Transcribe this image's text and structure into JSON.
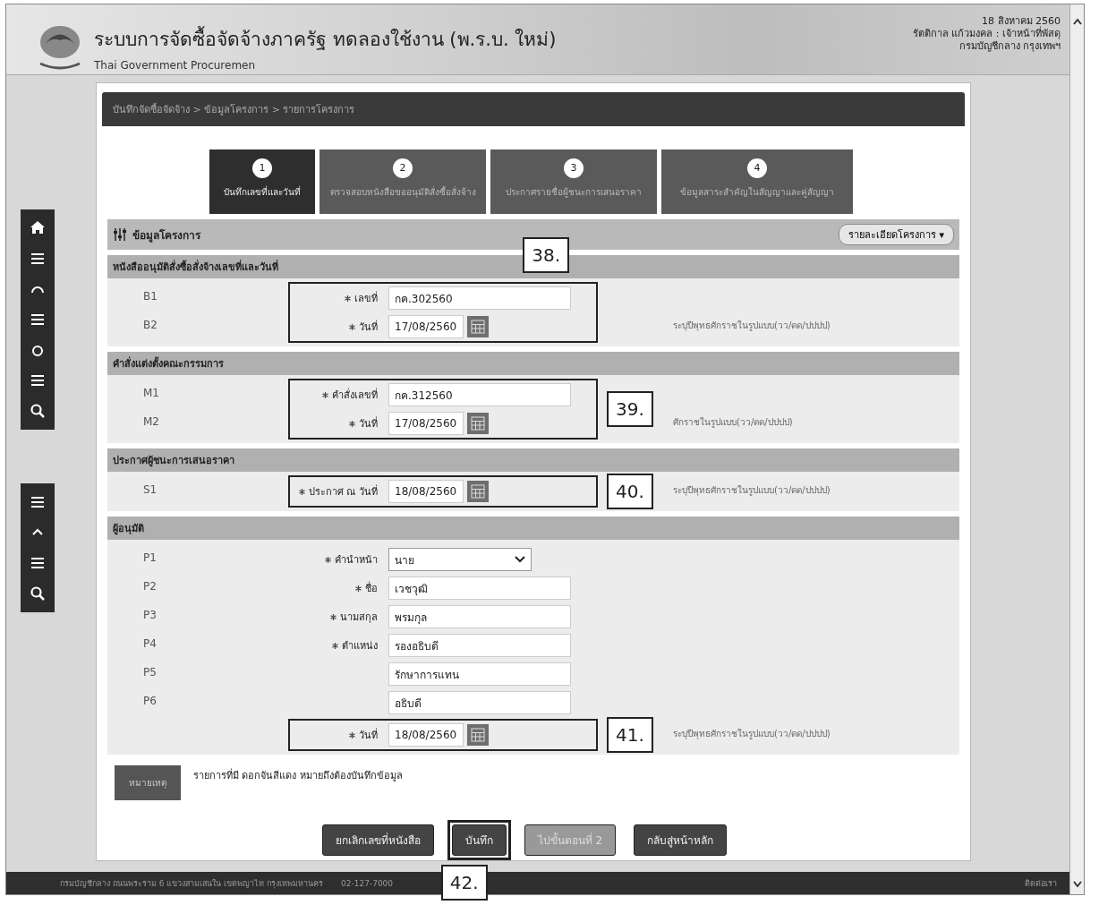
{
  "header": {
    "title": "ระบบการจัดซื้อจัดจ้างภาครัฐ ทดลองใช้งาน (พ.ร.บ. ใหม่)",
    "subtitle": "Thai Government Procuremen",
    "date": "18 สิงหาคม 2560",
    "user": "รัตติกาล แก้วมงคล : เจ้าหน้าที่พัสดุ",
    "agency": "กรมบัญชีกลาง กรุงเทพฯ"
  },
  "breadcrumb": "บันทึกจัดซื้อจัดจ้าง > ข้อมูลโครงการ > รายการโครงการ",
  "steps": [
    {
      "number": "1",
      "label": "บันทึกเลขที่และวันที่",
      "selected": true
    },
    {
      "number": "2",
      "label": "ตรวจสอบหนังสือขออนุมัติสั่งซื้อสั่งจ้าง",
      "selected": false
    },
    {
      "number": "3",
      "label": "ประกาศรายชื่อผู้ชนะการเสนอราคา",
      "selected": false
    },
    {
      "number": "4",
      "label": "ข้อมูลสาระสำคัญในสัญญาและคู่สัญญา",
      "selected": false
    }
  ],
  "panel": {
    "title": "ข้อมูลโครงการ",
    "menu": "รายละเอียดโครงการ ▾"
  },
  "sections": [
    {
      "title": "หนังสืออนุมัติสั่งซื้อสั่งจ้างเลขที่และวันที่",
      "groups": [
        {
          "callout": "38.",
          "rows": [
            {
              "code": "B1",
              "label": "เลขที่",
              "required": true,
              "kind": "text",
              "value": "กค.302560"
            },
            {
              "code": "B2",
              "label": "วันที่",
              "required": true,
              "kind": "date",
              "value": "17/08/2560",
              "hint": "ระบุปีพุทธศักราชในรูปแบบ(วว/ดด/ปปปป)"
            }
          ]
        }
      ]
    },
    {
      "title": "คำสั่งแต่งตั้งคณะกรรมการ",
      "groups": [
        {
          "callout": "39.",
          "rows": [
            {
              "code": "M1",
              "label": "คำสั่งเลขที่",
              "required": true,
              "kind": "text",
              "value": "กค.312560"
            },
            {
              "code": "M2",
              "label": "วันที่",
              "required": true,
              "kind": "date",
              "value": "17/08/2560",
              "hint": "ศักราชในรูปแบบ(วว/ดด/ปปปป)"
            }
          ]
        }
      ]
    },
    {
      "title": "ประกาศผู้ชนะการเสนอราคา",
      "groups": [
        {
          "callout": "40.",
          "rows": [
            {
              "code": "S1",
              "label": "ประกาศ ณ วันที่",
              "required": true,
              "kind": "date",
              "value": "18/08/2560",
              "hint": "ระบุปีพุทธศักราชในรูปแบบ(วว/ดด/ปปปป)"
            }
          ]
        }
      ]
    },
    {
      "title": "ผู้อนุมัติ",
      "groups": [
        {
          "rows": [
            {
              "code": "P1",
              "label": "คำนำหน้า",
              "required": true,
              "kind": "select",
              "value": "นาย"
            },
            {
              "code": "P2",
              "label": "ชื่อ",
              "required": true,
              "kind": "text",
              "value": "เวชวุฒิ"
            },
            {
              "code": "P3",
              "label": "นามสกุล",
              "required": true,
              "kind": "text",
              "value": "พรมกุล"
            },
            {
              "code": "P4",
              "label": "ตำแหน่ง",
              "required": true,
              "kind": "text",
              "value": "รองอธิบดี"
            },
            {
              "code": "P5",
              "kind": "text",
              "value": "รักษาการแทน"
            },
            {
              "code": "P6",
              "kind": "text",
              "value": "อธิบดี"
            }
          ]
        },
        {
          "callout": "41.",
          "rows": [
            {
              "label": "วันที่",
              "required": true,
              "kind": "date",
              "value": "18/08/2560",
              "hint": "ระบุปีพุทธศักราชในรูปแบบ(วว/ดด/ปปปป)"
            }
          ]
        }
      ]
    }
  ],
  "remark": {
    "tag": "หมายเหตุ",
    "text": "รายการที่มี ดอกจันสีแดง หมายถึงต้องบันทึกข้อมูล"
  },
  "buttons": [
    {
      "label": "ยกเลิกเลขที่หนังสือ",
      "highlight": false,
      "disabled": false
    },
    {
      "label": "บันทึก",
      "highlight": true,
      "disabled": false,
      "callout": "42."
    },
    {
      "label": "ไปขั้นตอนที่ 2",
      "highlight": false,
      "disabled": true
    },
    {
      "label": "กลับสู่หน้าหลัก",
      "highlight": false,
      "disabled": false
    }
  ],
  "footer": {
    "address": "กรมบัญชีกลาง ถนนพระราม 6 แขวงสามเสนใน เขตพญาไท กรุงเทพมหานคร",
    "phone": "02-127-7000",
    "link": "ติดต่อเรา"
  }
}
